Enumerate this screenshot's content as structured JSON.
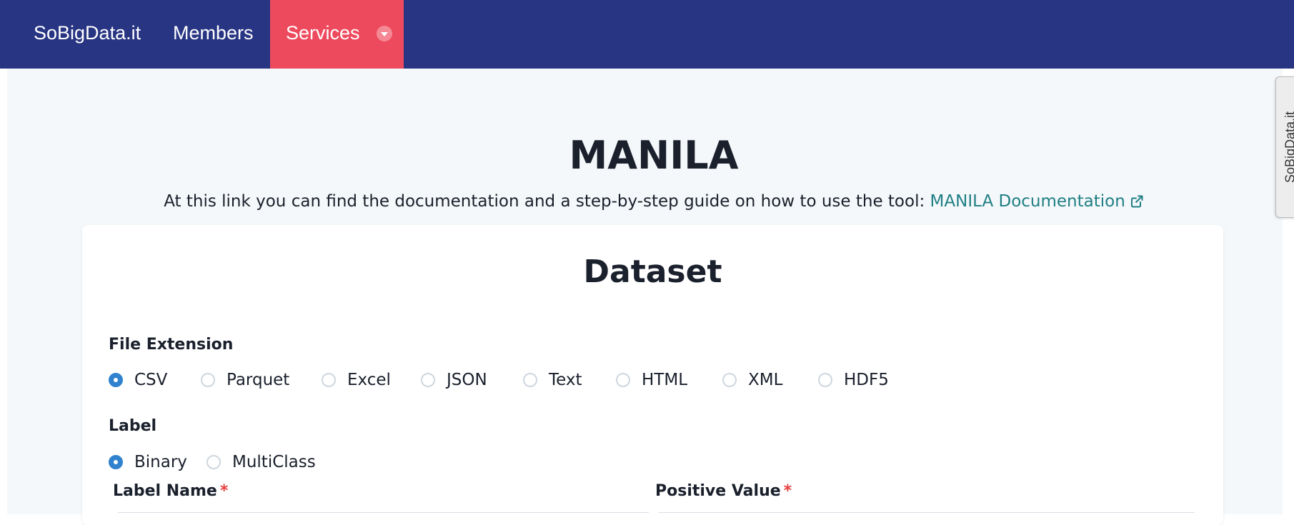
{
  "nav": {
    "brand": "SoBigData.it",
    "members": "Members",
    "services": "Services"
  },
  "side_tab": "SoBigData.it",
  "page": {
    "title": "MANILA",
    "doc_text": "At this link you can find the documentation and a step-by-step guide on how to use the tool: ",
    "doc_link": "MANILA Documentation"
  },
  "card": {
    "title": "Dataset",
    "file_extension": {
      "label": "File Extension",
      "options": [
        "CSV",
        "Parquet",
        "Excel",
        "JSON",
        "Text",
        "HTML",
        "XML",
        "HDF5"
      ],
      "selected": "CSV"
    },
    "label_section": {
      "label": "Label",
      "options": [
        "Binary",
        "MultiClass"
      ],
      "selected": "Binary"
    },
    "label_name": {
      "label": "Label Name",
      "required": "*"
    },
    "positive_value": {
      "label": "Positive Value",
      "required": "*"
    }
  },
  "colors": {
    "navbar": "#283583",
    "services_active": "#ee4a5d",
    "link": "#1e7f84",
    "radio_checked": "#3182ce",
    "required": "#e53e3e"
  }
}
